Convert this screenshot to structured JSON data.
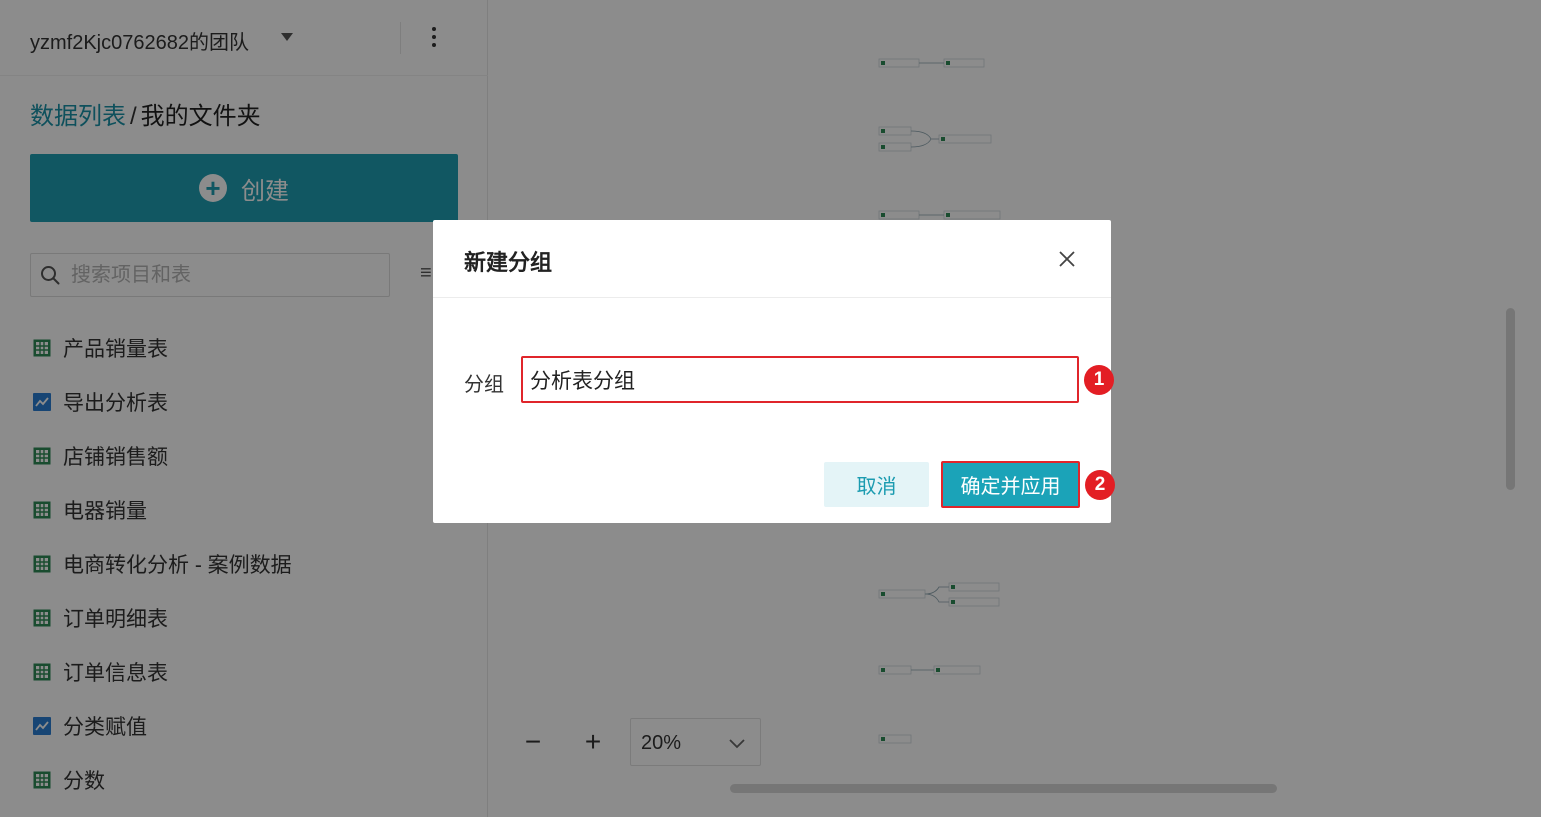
{
  "sidebar": {
    "team_name": "yzmf2Kjc0762682的团队",
    "breadcrumb": {
      "root": "数据列表",
      "separator": "/",
      "current": "我的文件夹"
    },
    "create_label": "创建",
    "search": {
      "placeholder": "搜索项目和表",
      "value": ""
    },
    "items": [
      {
        "label": "产品销量表",
        "icon": "table-icon"
      },
      {
        "label": "导出分析表",
        "icon": "chart-icon"
      },
      {
        "label": "店铺销售额",
        "icon": "table-icon"
      },
      {
        "label": "电器销量",
        "icon": "table-icon"
      },
      {
        "label": "电商转化分析 - 案例数据",
        "icon": "table-icon"
      },
      {
        "label": "订单明细表",
        "icon": "table-icon"
      },
      {
        "label": "订单信息表",
        "icon": "table-icon"
      },
      {
        "label": "分类赋值",
        "icon": "chart-icon"
      },
      {
        "label": "分数",
        "icon": "table-icon"
      }
    ]
  },
  "canvas": {
    "zoom": {
      "minus": "−",
      "plus": "+",
      "value": "20%"
    }
  },
  "dialog": {
    "title": "新建分组",
    "field_label": "分组",
    "field_value": "分析表分组",
    "cancel_label": "取消",
    "confirm_label": "确定并应用",
    "badges": [
      "1",
      "2"
    ]
  },
  "colors": {
    "accent": "#1ba3b8",
    "link": "#1a93a8",
    "highlight_border": "#e0252b",
    "badge": "#e31e24",
    "table_icon": "#2e8b57",
    "chart_icon": "#2a7fd4"
  }
}
